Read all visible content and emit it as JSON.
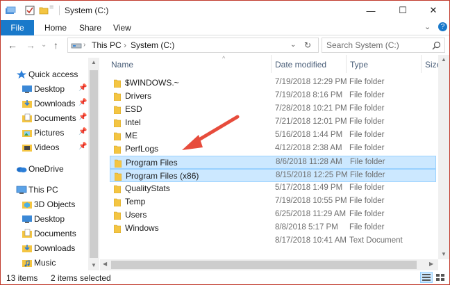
{
  "window": {
    "title": "System (C:)",
    "controls": {
      "minimize": "—",
      "maximize": "☐",
      "close": "✕"
    }
  },
  "ribbon": {
    "tabs": [
      "File",
      "Home",
      "Share",
      "View"
    ],
    "expand_glyph": "⌄",
    "help_glyph": "?"
  },
  "address": {
    "back_glyph": "←",
    "forward_glyph": "→",
    "history_glyph": "⌄",
    "up_glyph": "↑",
    "breadcrumbs": [
      "This PC",
      "System (C:)"
    ],
    "crumb_separator": "›",
    "dropdown_glyph": "⌄",
    "refresh_glyph": "↻",
    "search_placeholder": "Search System (C:)"
  },
  "nav": {
    "items": [
      {
        "label": "Quick access",
        "icon": "star-icon",
        "pinned": false
      },
      {
        "label": "Desktop",
        "icon": "desktop-icon",
        "pinned": true
      },
      {
        "label": "Downloads",
        "icon": "downloads-icon",
        "pinned": true
      },
      {
        "label": "Documents",
        "icon": "documents-icon",
        "pinned": true
      },
      {
        "label": "Pictures",
        "icon": "pictures-icon",
        "pinned": true
      },
      {
        "label": "Videos",
        "icon": "videos-icon",
        "pinned": true
      },
      {
        "label": "OneDrive",
        "icon": "onedrive-icon",
        "pinned": false
      },
      {
        "label": "This PC",
        "icon": "this-pc-icon",
        "pinned": false
      },
      {
        "label": "3D Objects",
        "icon": "3d-objects-icon",
        "pinned": false
      },
      {
        "label": "Desktop",
        "icon": "desktop-icon",
        "pinned": false
      },
      {
        "label": "Documents",
        "icon": "documents-icon",
        "pinned": false
      },
      {
        "label": "Downloads",
        "icon": "downloads-icon",
        "pinned": false
      },
      {
        "label": "Music",
        "icon": "music-icon",
        "pinned": false
      }
    ],
    "pin_glyph": "📌"
  },
  "columns": {
    "name": "Name",
    "date": "Date modified",
    "type": "Type",
    "size": "Size",
    "sort_glyph": "^"
  },
  "files": [
    {
      "name": "$WINDOWS.~",
      "date": "7/19/2018 12:29 PM",
      "type": "File folder",
      "selected": false,
      "kind": "folder"
    },
    {
      "name": "Drivers",
      "date": "7/19/2018 8:16 PM",
      "type": "File folder",
      "selected": false,
      "kind": "folder"
    },
    {
      "name": "ESD",
      "date": "7/28/2018 10:21 PM",
      "type": "File folder",
      "selected": false,
      "kind": "folder"
    },
    {
      "name": "Intel",
      "date": "7/21/2018 12:01 PM",
      "type": "File folder",
      "selected": false,
      "kind": "folder"
    },
    {
      "name": "ME",
      "date": "5/16/2018 1:44 PM",
      "type": "File folder",
      "selected": false,
      "kind": "folder"
    },
    {
      "name": "PerfLogs",
      "date": "4/12/2018 2:38 AM",
      "type": "File folder",
      "selected": false,
      "kind": "folder"
    },
    {
      "name": "Program Files",
      "date": "8/6/2018 11:28 AM",
      "type": "File folder",
      "selected": true,
      "kind": "folder"
    },
    {
      "name": "Program Files (x86)",
      "date": "8/15/2018 12:25 PM",
      "type": "File folder",
      "selected": true,
      "kind": "folder"
    },
    {
      "name": "QualityStats",
      "date": "5/17/2018 1:49 PM",
      "type": "File folder",
      "selected": false,
      "kind": "folder"
    },
    {
      "name": "Temp",
      "date": "7/19/2018 10:55 PM",
      "type": "File folder",
      "selected": false,
      "kind": "folder"
    },
    {
      "name": "Users",
      "date": "6/25/2018 11:29 AM",
      "type": "File folder",
      "selected": false,
      "kind": "folder"
    },
    {
      "name": "Windows",
      "date": "8/8/2018 5:17 PM",
      "type": "File folder",
      "selected": false,
      "kind": "folder"
    },
    {
      "name": "",
      "date": "8/17/2018 10:41 AM",
      "type": "Text Document",
      "selected": false,
      "kind": "document"
    }
  ],
  "status": {
    "items_count": "13 items",
    "selection": "2 items selected"
  },
  "colors": {
    "accent": "#1979ca",
    "selection_bg": "#cce8ff",
    "selection_border": "#99d1ff",
    "folder": "#f4c542",
    "annotation_arrow": "#e74c3c",
    "window_border": "#c0392b"
  }
}
